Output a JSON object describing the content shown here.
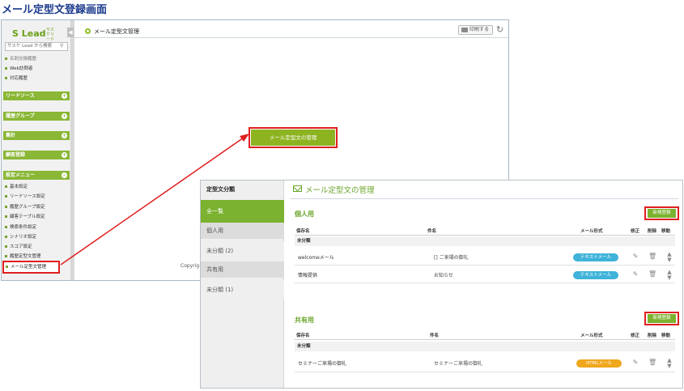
{
  "page_title": "メール定型文登録画面",
  "sidebar": {
    "logo_text": "S Lead",
    "logo_sub": "サスケリード",
    "search_placeholder": "サスケ Lead から検索",
    "top_items": [
      "名刺交換履歴",
      "Web訪問者",
      "対応履歴"
    ],
    "sections": [
      "リードソース",
      "履歴グループ",
      "集計",
      "顧客登録",
      "設定メニュー"
    ],
    "settings_items": [
      "基本設定",
      "リードソース設定",
      "履歴グループ設定",
      "顧客テーブル設定",
      "検索条件設定",
      "シナリオ設定",
      "スコア設定",
      "履歴定型文管理"
    ],
    "selected_item": "メール定型文管理"
  },
  "topbar": {
    "title": "メール定型文管理",
    "print_label": "印刷する"
  },
  "main": {
    "manage_button": "メール定型文の管理",
    "copyright": "Copyrig"
  },
  "panel": {
    "left_header": "定型文分類",
    "categories": [
      {
        "label": "全一覧",
        "kind": "active"
      },
      {
        "label": "個人用",
        "kind": "group"
      },
      {
        "label": "未分類 (2)",
        "kind": "item"
      },
      {
        "label": "共有用",
        "kind": "group"
      },
      {
        "label": "未分類 (1)",
        "kind": "item"
      }
    ],
    "title": "メール定型文の管理",
    "new_button": "新規登録",
    "columns": {
      "name": "保存名",
      "subject": "件名",
      "format": "メール形式",
      "edit": "修正",
      "delete": "削除",
      "move": "移動"
    },
    "personal": {
      "heading": "個人用",
      "group": "未分類",
      "rows": [
        {
          "name": "welcomeメール",
          "subject": "[] ご来場の御礼",
          "format": "テキストメール"
        },
        {
          "name": "情報提供",
          "subject": "お知らせ",
          "format": "テキストメール"
        }
      ]
    },
    "shared": {
      "heading": "共有用",
      "group": "未分類",
      "rows": [
        {
          "name": "セミナーご来場の御礼",
          "subject": "セミナーご来場の御礼",
          "format": "HTMLメール"
        }
      ]
    }
  },
  "colors": {
    "accent_green": "#7bb22f",
    "highlight_red": "#e01f1f",
    "text_badge": "#3fb3d9",
    "html_badge": "#f0a71c",
    "title_blue": "#1b3a8c"
  },
  "icons": {
    "edit": "pencil-icon",
    "delete": "trash-icon",
    "move": "updown-icon",
    "print": "printer-icon",
    "refresh": "refresh-icon"
  }
}
